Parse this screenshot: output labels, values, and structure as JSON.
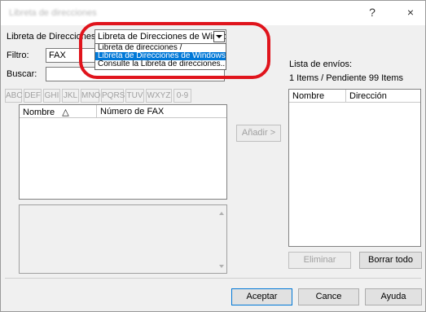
{
  "window": {
    "title": "Libreta de direcciones",
    "help_glyph": "?",
    "close_glyph": "×"
  },
  "address_book": {
    "label": "Libreta de Direcciones:",
    "selected": "Libreta de Direcciones de Windows",
    "options": [
      "Libreta de direcciones /",
      "Libreta de Direcciones de Windows",
      "Consulte la Libreta de direcciones..."
    ]
  },
  "filter": {
    "label": "Filtro:",
    "value": "FAX"
  },
  "search": {
    "label": "Buscar:",
    "value": ""
  },
  "alpha_tabs": [
    "ABC",
    "DEF",
    "GHI",
    "JKL",
    "MNO",
    "PQRS",
    "TUV",
    "WXYZ",
    "0-9"
  ],
  "left_list": {
    "columns": [
      "Nombre",
      "Número de FAX"
    ],
    "sort_glyph": "△"
  },
  "add_button": "Añadir >",
  "send_list": {
    "label": "Lista de envíos:",
    "count": "1 Items / Pendiente 99 Items",
    "columns": [
      "Nombre",
      "Dirección"
    ]
  },
  "buttons": {
    "delete": "Eliminar",
    "delete_all": "Borrar todo",
    "accept": "Aceptar",
    "cancel": "Cance",
    "help": "Ayuda"
  },
  "colors": {
    "highlight_ring": "#e0141c",
    "selection": "#0078d7"
  }
}
